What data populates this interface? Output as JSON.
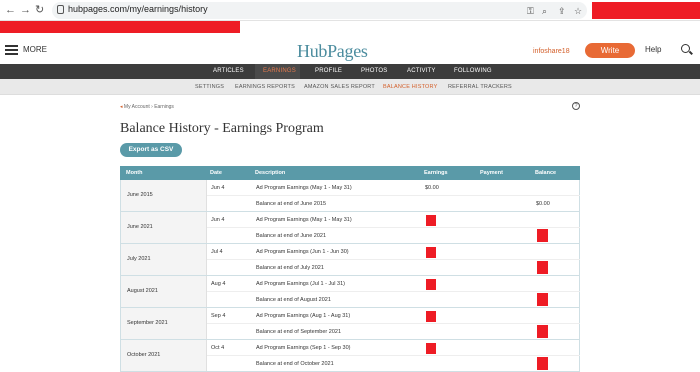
{
  "browser": {
    "url": "hubpages.com/my/earnings/history"
  },
  "header": {
    "more_label": "MORE",
    "logo": "HubPages",
    "username": "infoshare18",
    "write_label": "Write",
    "help_label": "Help"
  },
  "main_nav": [
    "ARTICLES",
    "EARNINGS",
    "PROFILE",
    "PHOTOS",
    "ACTIVITY",
    "FOLLOWING"
  ],
  "sub_nav": [
    "SETTINGS",
    "EARNINGS REPORTS",
    "AMAZON SALES REPORT",
    "BALANCE HISTORY",
    "REFERRAL TRACKERS"
  ],
  "breadcrumb": {
    "arrow": "◂",
    "text": "My Account › Earnings"
  },
  "help_icon": "?",
  "page_title": "Balance History - Earnings Program",
  "export_label": "Export as CSV",
  "table": {
    "headers": [
      "Month",
      "Date",
      "Description",
      "Earnings",
      "Payment",
      "Balance"
    ],
    "groups": [
      {
        "month": "June 2015",
        "date": "Jun 4",
        "description": "Ad Program Earnings (May 1 - May 31)",
        "earnings": "$0.00",
        "balance_desc": "Balance at end of June 2015",
        "balance": "$0.00"
      },
      {
        "month": "June 2021",
        "date": "Jun 4",
        "description": "Ad Program Earnings (May 1 - May 31)",
        "earnings": "",
        "balance_desc": "Balance at end of June 2021",
        "balance": ""
      },
      {
        "month": "July 2021",
        "date": "Jul 4",
        "description": "Ad Program Earnings (Jun 1 - Jun 30)",
        "earnings": "",
        "balance_desc": "Balance at end of July 2021",
        "balance": ""
      },
      {
        "month": "August 2021",
        "date": "Aug 4",
        "description": "Ad Program Earnings (Jul 1 - Jul 31)",
        "earnings": "",
        "balance_desc": "Balance at end of August 2021",
        "balance": ""
      },
      {
        "month": "September 2021",
        "date": "Sep 4",
        "description": "Ad Program Earnings (Aug 1 - Aug 31)",
        "earnings": "",
        "balance_desc": "Balance at end of September 2021",
        "balance": ""
      },
      {
        "month": "October 2021",
        "date": "Oct 4",
        "description": "Ad Program Earnings (Sep 1 - Sep 30)",
        "earnings": "",
        "balance_desc": "Balance at end of October 2021",
        "balance": ""
      }
    ]
  }
}
